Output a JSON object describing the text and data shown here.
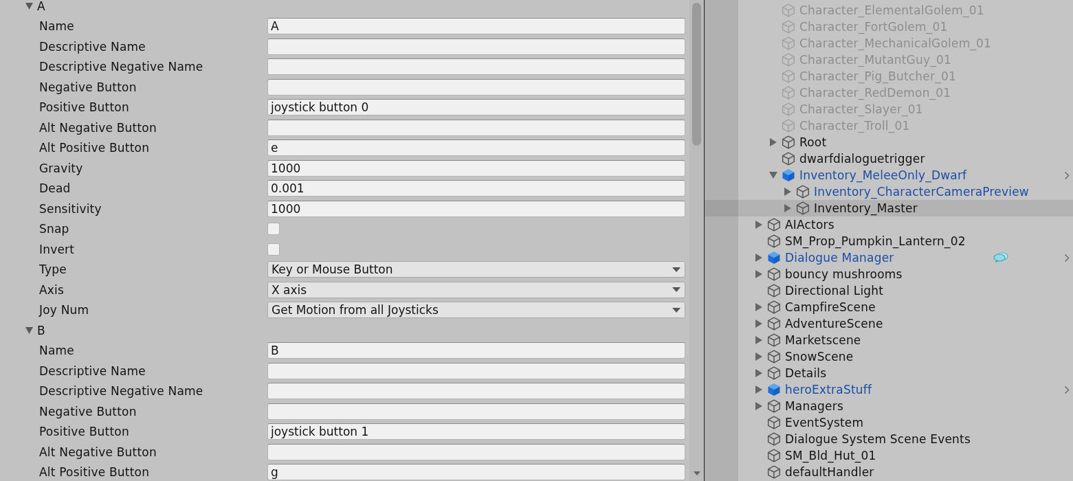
{
  "inspector": {
    "axes": [
      {
        "name": "A",
        "expanded": true,
        "fields": [
          {
            "kind": "text",
            "label": "Name",
            "value": "A"
          },
          {
            "kind": "text",
            "label": "Descriptive Name"
          },
          {
            "kind": "text",
            "label": "Descriptive Negative Name"
          },
          {
            "kind": "text",
            "label": "Negative Button"
          },
          {
            "kind": "text",
            "label": "Positive Button",
            "value": "joystick button 0"
          },
          {
            "kind": "text",
            "label": "Alt Negative Button"
          },
          {
            "kind": "text",
            "label": "Alt Positive Button",
            "value": "e"
          },
          {
            "kind": "text",
            "label": "Gravity",
            "value": "1000"
          },
          {
            "kind": "text",
            "label": "Dead",
            "value": "0.001"
          },
          {
            "kind": "text",
            "label": "Sensitivity",
            "value": "1000"
          },
          {
            "kind": "checkbox",
            "label": "Snap",
            "checked": false
          },
          {
            "kind": "checkbox",
            "label": "Invert",
            "checked": false
          },
          {
            "kind": "dropdown",
            "label": "Type",
            "value": "Key or Mouse Button"
          },
          {
            "kind": "dropdown",
            "label": "Axis",
            "value": "X axis"
          },
          {
            "kind": "dropdown",
            "label": "Joy Num",
            "value": "Get Motion from all Joysticks"
          }
        ]
      },
      {
        "name": "B",
        "expanded": true,
        "fields": [
          {
            "kind": "text",
            "label": "Name",
            "value": "B"
          },
          {
            "kind": "text",
            "label": "Descriptive Name"
          },
          {
            "kind": "text",
            "label": "Descriptive Negative Name"
          },
          {
            "kind": "text",
            "label": "Negative Button"
          },
          {
            "kind": "text",
            "label": "Positive Button",
            "value": "joystick button 1"
          },
          {
            "kind": "text",
            "label": "Alt Negative Button"
          },
          {
            "kind": "text",
            "label": "Alt Positive Button",
            "value": "g"
          }
        ]
      }
    ]
  },
  "hierarchy": {
    "items": [
      {
        "children": [
          {
            "label": "Character_ElementalGolem_01",
            "kind": "object",
            "active": false,
            "selected": false,
            "badge": false
          },
          {
            "label": "Character_FortGolem_01",
            "kind": "object",
            "active": false,
            "selected": false,
            "badge": false
          },
          {
            "label": "Character_MechanicalGolem_01",
            "kind": "object",
            "active": false,
            "selected": false,
            "badge": false
          },
          {
            "label": "Character_MutantGuy_01",
            "kind": "object",
            "active": false,
            "selected": false,
            "badge": false
          },
          {
            "label": "Character_Pig_Butcher_01",
            "kind": "object",
            "active": false,
            "selected": false,
            "badge": false
          },
          {
            "label": "Character_RedDemon_01",
            "kind": "object",
            "active": false,
            "selected": false,
            "badge": false
          },
          {
            "label": "Character_Slayer_01",
            "kind": "object",
            "active": false,
            "selected": false,
            "badge": false
          },
          {
            "label": "Character_Troll_01",
            "kind": "object",
            "active": false,
            "selected": false,
            "badge": false
          },
          {
            "label": "Root",
            "kind": "object",
            "active": true,
            "selected": false,
            "badge": false,
            "expanded": false
          },
          {
            "label": "dwarfdialoguetrigger",
            "kind": "object",
            "active": true,
            "selected": false,
            "badge": false
          },
          {
            "label": "Inventory_MeleeOnly_Dwarf",
            "kind": "prefab",
            "active": true,
            "selected": false,
            "badge": false,
            "expanded": true,
            "children": [
              {
                "label": "Inventory_CharacterCameraPreview",
                "kind": "prefab_member",
                "active": true,
                "selected": false,
                "badge": false,
                "expanded": false
              },
              {
                "label": "Inventory_Master",
                "kind": "object",
                "active": true,
                "selected": true,
                "badge": false,
                "expanded": false
              }
            ]
          }
        ]
      },
      {
        "label": "AIActors",
        "kind": "object",
        "active": true,
        "selected": false,
        "badge": false,
        "expanded": false
      },
      {
        "label": "SM_Prop_Pumpkin_Lantern_02",
        "kind": "object",
        "active": true,
        "selected": false,
        "badge": false
      },
      {
        "label": "Dialogue Manager",
        "kind": "prefab",
        "active": true,
        "selected": false,
        "badge": true,
        "expanded": false
      },
      {
        "label": "bouncy mushrooms",
        "kind": "object",
        "active": true,
        "selected": false,
        "badge": false,
        "expanded": false
      },
      {
        "label": "Directional Light",
        "kind": "object",
        "active": true,
        "selected": false,
        "badge": false
      },
      {
        "label": "CampfireScene",
        "kind": "object",
        "active": true,
        "selected": false,
        "badge": false,
        "expanded": false
      },
      {
        "label": "AdventureScene",
        "kind": "object",
        "active": true,
        "selected": false,
        "badge": false,
        "expanded": false
      },
      {
        "label": "Marketscene",
        "kind": "object",
        "active": true,
        "selected": false,
        "badge": false,
        "expanded": false
      },
      {
        "label": "SnowScene",
        "kind": "object",
        "active": true,
        "selected": false,
        "badge": false,
        "expanded": false
      },
      {
        "label": "Details",
        "kind": "object",
        "active": true,
        "selected": false,
        "badge": false,
        "expanded": false
      },
      {
        "label": "heroExtraStuff",
        "kind": "prefab",
        "active": true,
        "selected": false,
        "badge": false,
        "expanded": false
      },
      {
        "label": "Managers",
        "kind": "object",
        "active": true,
        "selected": false,
        "badge": false,
        "expanded": false
      },
      {
        "label": "EventSystem",
        "kind": "object",
        "active": true,
        "selected": false,
        "badge": false
      },
      {
        "label": "Dialogue System Scene Events",
        "kind": "object",
        "active": true,
        "selected": false,
        "badge": false
      },
      {
        "label": "SM_Bld_Hut_01",
        "kind": "object",
        "active": true,
        "selected": false,
        "badge": false
      },
      {
        "label": "defaultHandler",
        "kind": "object",
        "active": true,
        "selected": false,
        "badge": false
      }
    ]
  }
}
